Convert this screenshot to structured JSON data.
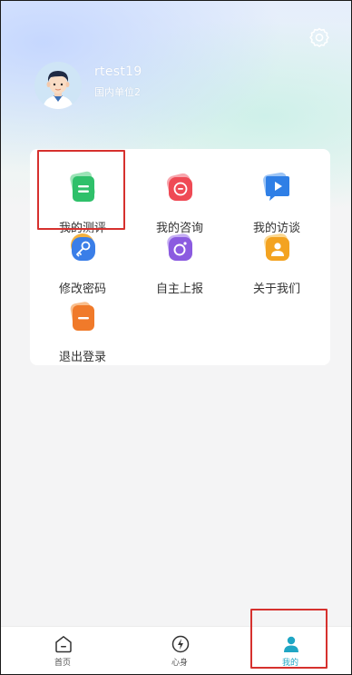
{
  "profile": {
    "username": "rtest19",
    "unit": "国内单位2"
  },
  "menu": [
    {
      "label": "我的测评",
      "icon": "assessment-icon",
      "color": "#2fc06a"
    },
    {
      "label": "我的咨询",
      "icon": "consult-icon",
      "color": "#ef4a55"
    },
    {
      "label": "我的访谈",
      "icon": "interview-icon",
      "color": "#2f7fe6"
    },
    {
      "label": "修改密码",
      "icon": "key-icon",
      "color": "#3a7ee8"
    },
    {
      "label": "自主上报",
      "icon": "report-icon",
      "color": "#8b5be0"
    },
    {
      "label": "关于我们",
      "icon": "about-icon",
      "color": "#f3a321"
    },
    {
      "label": "退出登录",
      "icon": "logout-icon",
      "color": "#f07a2a"
    }
  ],
  "tabbar": [
    {
      "label": "首页",
      "icon": "home-icon",
      "active": false
    },
    {
      "label": "心身",
      "icon": "mind-body-icon",
      "active": false
    },
    {
      "label": "我的",
      "icon": "profile-icon",
      "active": true
    }
  ],
  "colors": {
    "accent": "#1fa6c4",
    "highlight": "#d6312e"
  }
}
